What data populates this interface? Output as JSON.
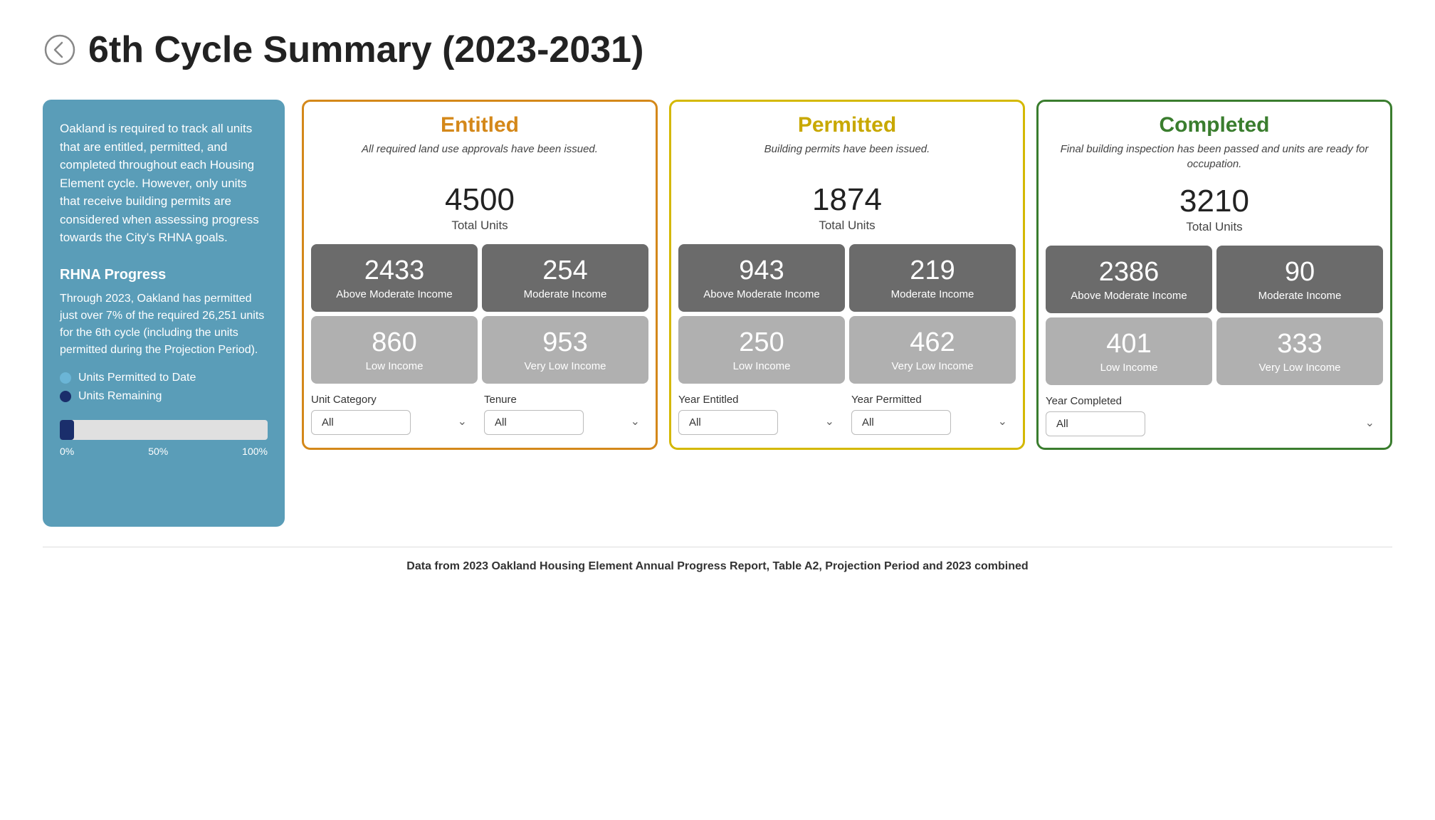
{
  "header": {
    "title": "6th Cycle Summary (2023-2031)"
  },
  "sidebar": {
    "description": "Oakland is required to track all units that are entitled, permitted, and completed throughout each Housing Element cycle. However, only units that receive building permits are considered when assessing progress towards the City's RHNA goals.",
    "rhna_title": "RHNA Progress",
    "rhna_text": "Through 2023, Oakland has permitted just over 7% of the required 26,251 units for the 6th cycle (including the units permitted during the Projection Period).",
    "legend": [
      {
        "label": "Units Permitted to Date",
        "type": "light"
      },
      {
        "label": "Units Remaining",
        "type": "dark"
      }
    ],
    "progress": {
      "percent": 7,
      "labels": [
        "0%",
        "50%",
        "100%"
      ]
    }
  },
  "cards": [
    {
      "id": "entitled",
      "title": "Entitled",
      "subtitle": "All required land use approvals have been issued.",
      "total": "4500",
      "total_label": "Total Units",
      "income_items": [
        {
          "number": "2433",
          "label": "Above Moderate Income",
          "shade": "dark"
        },
        {
          "number": "254",
          "label": "Moderate Income",
          "shade": "dark"
        },
        {
          "number": "860",
          "label": "Low Income",
          "shade": "light"
        },
        {
          "number": "953",
          "label": "Very Low Income",
          "shade": "light"
        }
      ],
      "filters": [
        {
          "label": "Unit Category",
          "value": "All"
        },
        {
          "label": "Tenure",
          "value": "All"
        }
      ]
    },
    {
      "id": "permitted",
      "title": "Permitted",
      "subtitle": "Building permits have been issued.",
      "total": "1874",
      "total_label": "Total Units",
      "income_items": [
        {
          "number": "943",
          "label": "Above Moderate Income",
          "shade": "dark"
        },
        {
          "number": "219",
          "label": "Moderate Income",
          "shade": "dark"
        },
        {
          "number": "250",
          "label": "Low Income",
          "shade": "light"
        },
        {
          "number": "462",
          "label": "Very Low Income",
          "shade": "light"
        }
      ],
      "filters": [
        {
          "label": "Year Entitled",
          "value": "All"
        },
        {
          "label": "Year Permitted",
          "value": "All"
        }
      ]
    },
    {
      "id": "completed",
      "title": "Completed",
      "subtitle": "Final building inspection has been passed and units are ready for occupation.",
      "total": "3210",
      "total_label": "Total Units",
      "income_items": [
        {
          "number": "2386",
          "label": "Above Moderate Income",
          "shade": "dark"
        },
        {
          "number": "90",
          "label": "Moderate Income",
          "shade": "dark"
        },
        {
          "number": "401",
          "label": "Low Income",
          "shade": "light"
        },
        {
          "number": "333",
          "label": "Very Low Income",
          "shade": "light"
        }
      ],
      "filters": [
        {
          "label": "Year Completed",
          "value": "All"
        }
      ]
    }
  ],
  "footer": {
    "text": "Data from 2023 Oakland Housing Element Annual Progress Report, Table A2, Projection Period and 2023 combined"
  }
}
